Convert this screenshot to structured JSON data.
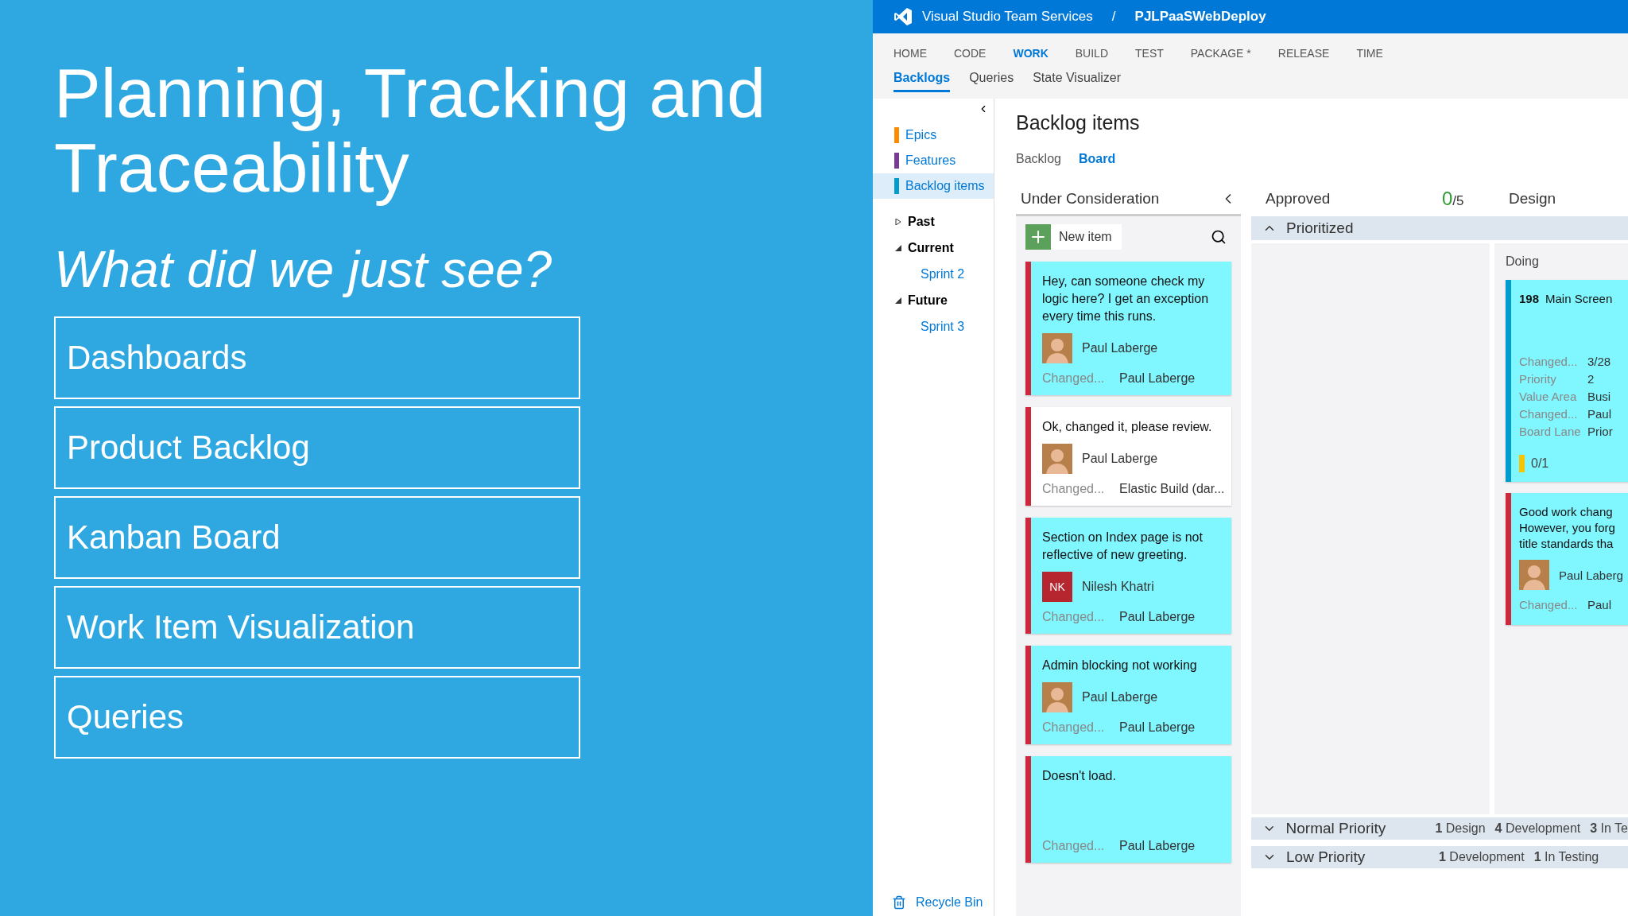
{
  "slide": {
    "title": "Planning, Tracking and Traceability",
    "subtitle": "What did we just see?",
    "items": [
      "Dashboards",
      "Product Backlog",
      "Kanban Board",
      "Work Item Visualization",
      "Queries"
    ]
  },
  "app": {
    "header": {
      "product": "Visual Studio Team Services",
      "separator": "/",
      "project": "PJLPaaSWebDeploy"
    },
    "hubs": [
      {
        "label": "HOME",
        "selected": false
      },
      {
        "label": "CODE",
        "selected": false
      },
      {
        "label": "WORK",
        "selected": true
      },
      {
        "label": "BUILD",
        "selected": false
      },
      {
        "label": "TEST",
        "selected": false
      },
      {
        "label": "PACKAGE *",
        "selected": false
      },
      {
        "label": "RELEASE",
        "selected": false
      },
      {
        "label": "TIME",
        "selected": false
      }
    ],
    "subtabs": [
      {
        "label": "Backlogs",
        "selected": true
      },
      {
        "label": "Queries",
        "selected": false
      },
      {
        "label": "State Visualizer",
        "selected": false
      }
    ],
    "sidebar": {
      "backlogs": [
        {
          "label": "Epics",
          "color": "#ff8c00",
          "selected": false
        },
        {
          "label": "Features",
          "color": "#773b93",
          "selected": false
        },
        {
          "label": "Backlog items",
          "color": "#009ccc",
          "selected": true
        }
      ],
      "iterations": [
        {
          "label": "Past",
          "expanded": false
        },
        {
          "label": "Current",
          "expanded": true,
          "children": [
            {
              "label": "Sprint 2"
            }
          ]
        },
        {
          "label": "Future",
          "expanded": true,
          "children": [
            {
              "label": "Sprint 3"
            }
          ]
        }
      ],
      "recycle_bin": "Recycle Bin"
    },
    "page_title": "Backlog items",
    "view_tabs": [
      {
        "label": "Backlog",
        "selected": false
      },
      {
        "label": "Board",
        "selected": true
      }
    ],
    "columns": [
      {
        "name": "Under Consideration"
      },
      {
        "name": "Approved",
        "count": "0",
        "limit": "/5"
      },
      {
        "name": "Design"
      }
    ],
    "new_item": "New item",
    "cards": [
      {
        "title": "Hey, can someone check my logic here?  I get an exception every time this runs.",
        "avatar": {
          "kind": "photo"
        },
        "assignee": "Paul Laberge",
        "color": "#cc293d",
        "selected": false,
        "field_label": "Changed...",
        "field_value": "Paul Laberge"
      },
      {
        "title": "Ok, changed it, please review.",
        "avatar": {
          "kind": "photo"
        },
        "assignee": "Paul Laberge",
        "color": "#cc293d",
        "selected": true,
        "field_label": "Changed...",
        "field_value": "Elastic Build (dar..."
      },
      {
        "title": "Section on Index page is not reflective of new greeting.",
        "avatar": {
          "kind": "initials",
          "initials": "NK"
        },
        "assignee": "Nilesh Khatri",
        "color": "#cc293d",
        "selected": false,
        "field_label": "Changed...",
        "field_value": "Paul Laberge"
      },
      {
        "title": "Admin blocking not working",
        "avatar": {
          "kind": "photo"
        },
        "assignee": "Paul Laberge",
        "color": "#cc293d",
        "selected": false,
        "field_label": "Changed...",
        "field_value": "Paul Laberge"
      },
      {
        "title": "Doesn't load.",
        "color": "#cc293d",
        "selected": false,
        "field_label": "Changed...",
        "field_value": "Paul Laberge"
      }
    ],
    "lanes": [
      {
        "name": "Prioritized",
        "expanded": true,
        "sub_column": "Doing",
        "cards": [
          {
            "id": "198",
            "title_lines": [
              "Main Screen"
            ],
            "color": "#009ccc",
            "fields": [
              {
                "label": "Changed...",
                "value": "3/28"
              },
              {
                "label": "Priority",
                "value": "2"
              },
              {
                "label": "Value Area",
                "value": "Busi"
              },
              {
                "label": "Changed...",
                "value": "Paul"
              },
              {
                "label": "Board Lane",
                "value": "Prior"
              }
            ],
            "tasks": "0/1"
          },
          {
            "title_lines": [
              "Good work chang",
              "However, you forg",
              "title standards tha"
            ],
            "color": "#cc293d",
            "assignee": "Paul Laberg",
            "fields": [
              {
                "label": "Changed...",
                "value": "Paul"
              }
            ]
          }
        ]
      },
      {
        "name": "Normal Priority",
        "expanded": false,
        "summary": [
          {
            "count": "1",
            "label": "Design"
          },
          {
            "count": "4",
            "label": "Development"
          },
          {
            "count": "3",
            "label": "In Te"
          }
        ]
      },
      {
        "name": "Low Priority",
        "expanded": false,
        "summary": [
          {
            "count": "1",
            "label": "Development"
          },
          {
            "count": "1",
            "label": "In Testing"
          }
        ]
      }
    ]
  }
}
